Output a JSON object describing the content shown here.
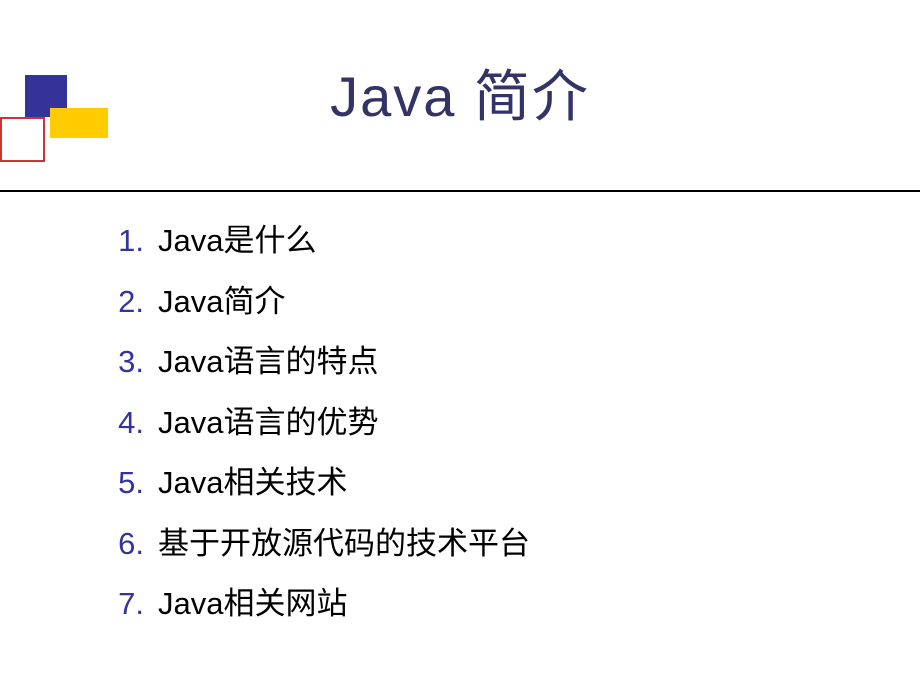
{
  "title": "Java 简介",
  "items": [
    {
      "num": "1.",
      "text": "Java是什么"
    },
    {
      "num": "2.",
      "text": "Java简介"
    },
    {
      "num": "3.",
      "text": "Java语言的特点"
    },
    {
      "num": "4.",
      "text": "Java语言的优势"
    },
    {
      "num": "5.",
      "text": "Java相关技术"
    },
    {
      "num": "6.",
      "text": "基于开放源代码的技术平台"
    },
    {
      "num": "7.",
      "text": "Java相关网站"
    }
  ]
}
